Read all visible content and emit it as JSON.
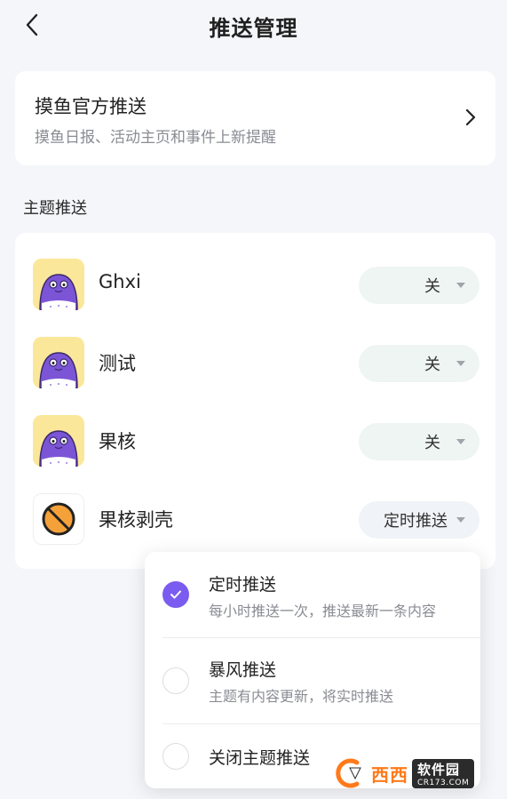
{
  "header": {
    "title": "推送管理",
    "back_icon": "chevron-left-icon"
  },
  "official": {
    "title": "摸鱼官方推送",
    "subtitle": "摸鱼日报、活动主页和事件上新提醒",
    "chevron_icon": "chevron-right-icon"
  },
  "topics_section": {
    "label": "主题推送",
    "items": [
      {
        "name": "Ghxi",
        "setting": "关",
        "avatar": "purple-creature-avatar"
      },
      {
        "name": "测试",
        "setting": "关",
        "avatar": "purple-creature-avatar"
      },
      {
        "name": "果核",
        "setting": "关",
        "avatar": "purple-creature-avatar"
      },
      {
        "name": "果核剥壳",
        "setting": "定时推送",
        "avatar": "orange-slash-circle-avatar"
      }
    ]
  },
  "dropdown": {
    "options": [
      {
        "title": "定时推送",
        "desc": "每小时推送一次，推送最新一条内容",
        "selected": true
      },
      {
        "title": "暴风推送",
        "desc": "主题有内容更新，将实时推送",
        "selected": false
      },
      {
        "title": "关闭主题推送",
        "desc": "",
        "selected": false
      }
    ]
  },
  "watermark": {
    "brand": "西西",
    "text": "软件园",
    "url": "CR173.COM"
  },
  "colors": {
    "accent": "#7b5cf0",
    "background": "#f5f6fa",
    "avatar_bg": "#fbe79a",
    "pill_bg": "#eef5f3"
  }
}
